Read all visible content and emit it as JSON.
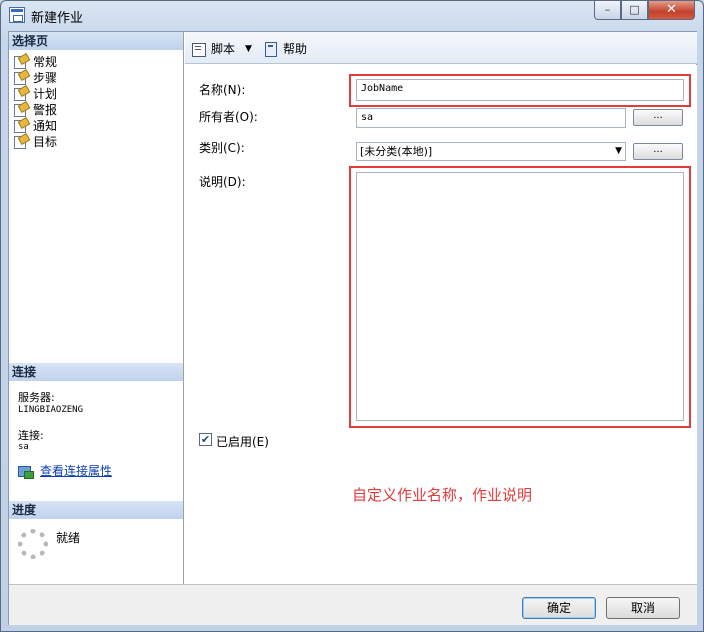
{
  "window": {
    "title": "新建作业",
    "close_glyph": "✕",
    "maximize_glyph": "□",
    "minimize_glyph": "–"
  },
  "sidebar": {
    "select_page_header": "选择页",
    "pages": [
      {
        "label": "常规",
        "icon": "page-icon"
      },
      {
        "label": "步骤",
        "icon": "page-icon"
      },
      {
        "label": "计划",
        "icon": "page-icon"
      },
      {
        "label": "警报",
        "icon": "page-icon"
      },
      {
        "label": "通知",
        "icon": "page-icon"
      },
      {
        "label": "目标",
        "icon": "page-icon"
      }
    ],
    "connection_header": "连接",
    "server_label": "服务器:",
    "server_value": "LINGBIAOZENG",
    "connection_label": "连接:",
    "connection_value": "sa",
    "view_connection_link": "查看连接属性",
    "progress_header": "进度",
    "progress_status": "就绪"
  },
  "toolbar": {
    "script_label": "脚本",
    "help_label": "帮助"
  },
  "form": {
    "name_label": "名称(N):",
    "name_value": "JobName",
    "owner_label": "所有者(O):",
    "owner_value": "sa",
    "category_label": "类别(C):",
    "category_value": "[未分类(本地)]",
    "description_label": "说明(D):",
    "description_value": "",
    "browse_label": "...",
    "enabled_label": "已启用(E)",
    "enabled": true,
    "annotation": "自定义作业名称，作业说明",
    "highlight_color": "#e03c3c"
  },
  "footer": {
    "ok_label": "确定",
    "cancel_label": "取消"
  }
}
